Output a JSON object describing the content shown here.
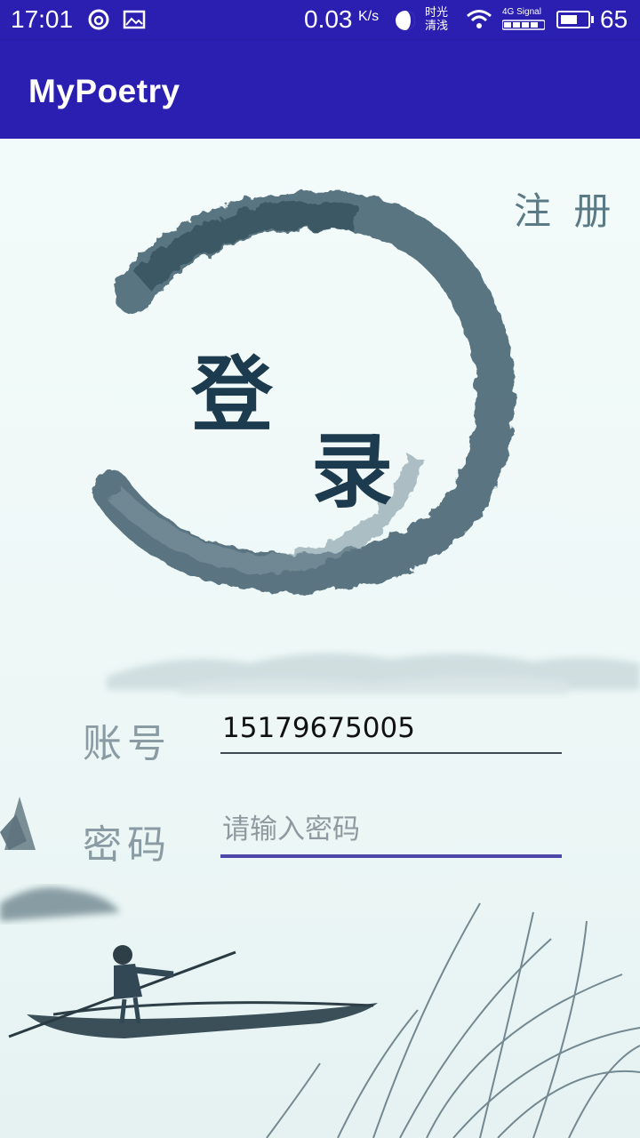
{
  "status_bar": {
    "time": "17:01",
    "net_speed": "0.03",
    "net_speed_unit": "K/s",
    "brightness_label_1": "时光",
    "brightness_label_2": "清浅",
    "signal_label": "4G Signal",
    "battery_level": "65",
    "icons": [
      "netease-music-icon",
      "gallery-icon",
      "hd-brightness-icon",
      "wifi-icon",
      "signal-icon",
      "battery-icon"
    ]
  },
  "app_bar": {
    "title": "MyPoetry"
  },
  "login": {
    "register_link": "注 册",
    "title_char_1": "登",
    "title_char_2": "录",
    "account_label": "账号",
    "account_value": "15179675005",
    "password_label": "密码",
    "password_placeholder": "请输入密码"
  },
  "colors": {
    "app_bar": "#2a1fb0",
    "accent_underline": "#4c47a8",
    "ink": "#1d3b4e"
  }
}
